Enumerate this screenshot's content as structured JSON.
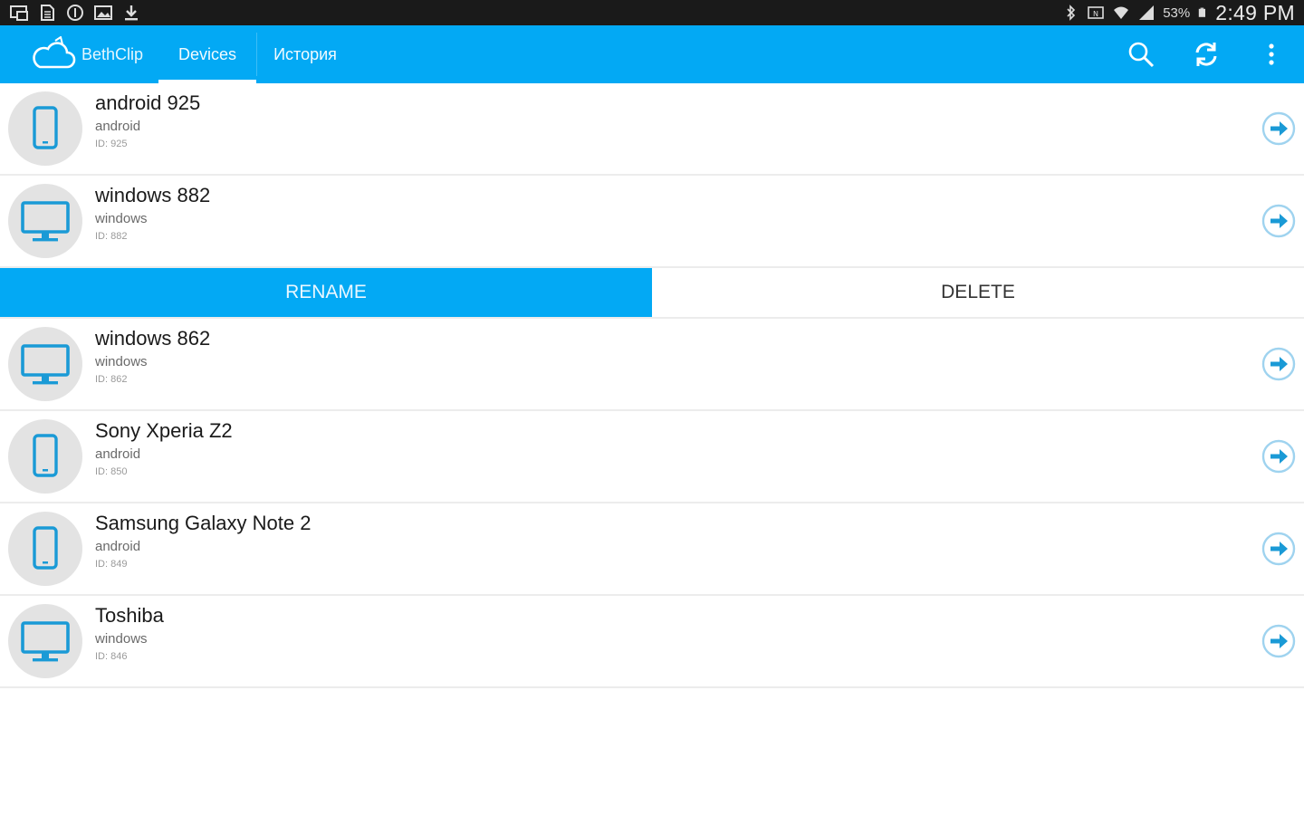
{
  "status_bar": {
    "battery": "53%",
    "time": "2:49 PM"
  },
  "app_bar": {
    "brand": "BethClip",
    "tabs": [
      {
        "label": "Devices",
        "active": true
      },
      {
        "label": "История",
        "active": false
      }
    ],
    "actions": [
      "search-icon",
      "refresh-icon",
      "more-vert-icon"
    ]
  },
  "devices": [
    {
      "name": "android 925",
      "type": "android",
      "id": "ID: 925",
      "icon": "phone-icon"
    },
    {
      "name": "windows 882",
      "type": "windows",
      "id": "ID: 882",
      "icon": "monitor-icon"
    },
    {
      "name": "windows 862",
      "type": "windows",
      "id": "ID: 862",
      "icon": "monitor-icon"
    },
    {
      "name": "Sony Xperia Z2",
      "type": "android",
      "id": "ID: 850",
      "icon": "phone-icon"
    },
    {
      "name": "Samsung Galaxy Note 2",
      "type": "android",
      "id": "ID: 849",
      "icon": "phone-icon"
    },
    {
      "name": "Toshiba",
      "type": "windows",
      "id": "ID: 846",
      "icon": "monitor-icon"
    }
  ],
  "row_actions": {
    "rename": "RENAME",
    "delete": "DELETE"
  },
  "colors": {
    "accent": "#03a9f4",
    "icon_blue": "#1a9ad6",
    "status_bar": "#1a1a1a"
  }
}
